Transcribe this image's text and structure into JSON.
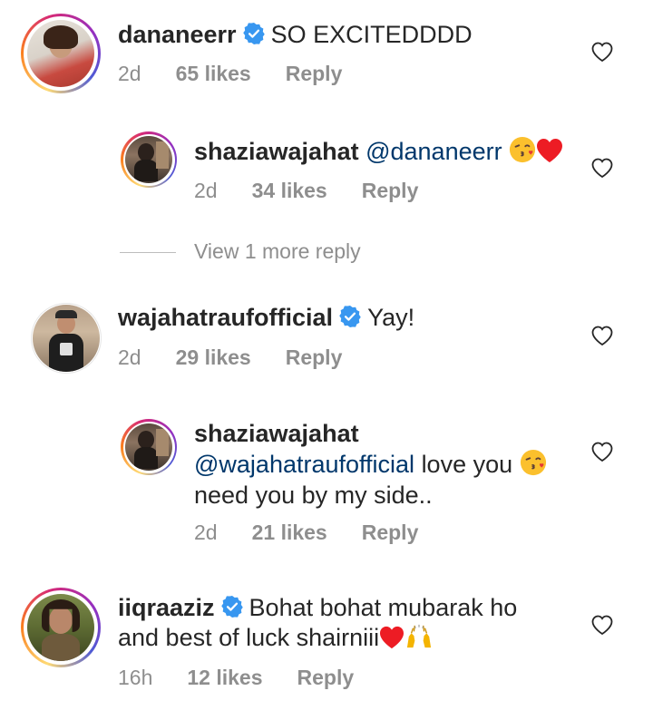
{
  "comments": [
    {
      "username": "dananeerr",
      "verified": true,
      "text": "SO EXCITEDDDD",
      "time": "2d",
      "likes": "65 likes",
      "reply": "Reply"
    },
    {
      "username": "shaziawajahat",
      "verified": false,
      "mention": "@dananeerr",
      "text": "",
      "emoji": [
        "kissing-face-emoji",
        "red-heart-emoji"
      ],
      "time": "2d",
      "likes": "34 likes",
      "reply": "Reply"
    },
    {
      "username": "wajahatraufofficial",
      "verified": true,
      "text": "Yay!",
      "time": "2d",
      "likes": "29 likes",
      "reply": "Reply"
    },
    {
      "username": "shaziawajahat",
      "verified": false,
      "mention": "@wajahatraufofficial",
      "text": "love you",
      "text2": "need you by my side..",
      "emoji": [
        "kissing-face-emoji"
      ],
      "time": "2d",
      "likes": "21 likes",
      "reply": "Reply"
    },
    {
      "username": "iiqraaziz",
      "verified": true,
      "text": "Bohat bohat mubarak ho",
      "text2": "and best of luck shairniii",
      "emoji": [
        "red-heart-emoji",
        "raising-hands-emoji"
      ],
      "time": "16h",
      "likes": "12 likes",
      "reply": "Reply"
    }
  ],
  "view_more": "View 1 more reply",
  "colors": {
    "verified_blue": "#3897f0",
    "mention": "#00376b",
    "meta_gray": "#8e8e8e",
    "heart_red": "#ed1c24"
  }
}
